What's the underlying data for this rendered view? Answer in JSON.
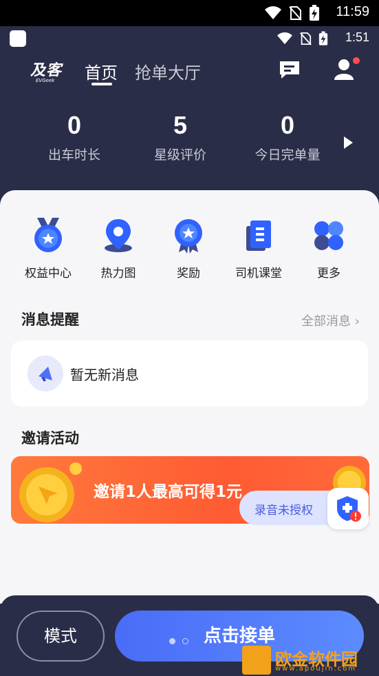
{
  "system_status": {
    "time": "11:59"
  },
  "app_status": {
    "time": "1:51"
  },
  "header": {
    "logo_text": "及客",
    "logo_sub": "EVGeek",
    "tab_home": "首页",
    "tab_grab": "抢单大厅",
    "has_notification_dot": true
  },
  "stats": [
    {
      "value": "0",
      "label": "出车时长"
    },
    {
      "value": "5",
      "label": "星级评价"
    },
    {
      "value": "0",
      "label": "今日完单量"
    }
  ],
  "quick_links": [
    {
      "label": "权益中心",
      "icon": "medal-icon"
    },
    {
      "label": "热力图",
      "icon": "location-pin-icon"
    },
    {
      "label": "奖励",
      "icon": "award-ribbon-icon"
    },
    {
      "label": "司机课堂",
      "icon": "book-icon"
    },
    {
      "label": "更多",
      "icon": "grid-more-icon"
    }
  ],
  "messages": {
    "title": "消息提醒",
    "all_link": "全部消息",
    "empty_text": "暂无新消息"
  },
  "invite": {
    "title": "邀请活动",
    "banner_text": "邀请1人最高可得1元"
  },
  "recording": {
    "label": "录音未授权"
  },
  "bottom": {
    "mode_label": "模式",
    "order_label": "点击接单"
  },
  "watermark": {
    "text": "欧金软件园",
    "url": "www.apoujin.com"
  },
  "colors": {
    "dark": "#2a2d47",
    "accent": "#4a6cf7",
    "banner": "#ff5b33"
  }
}
